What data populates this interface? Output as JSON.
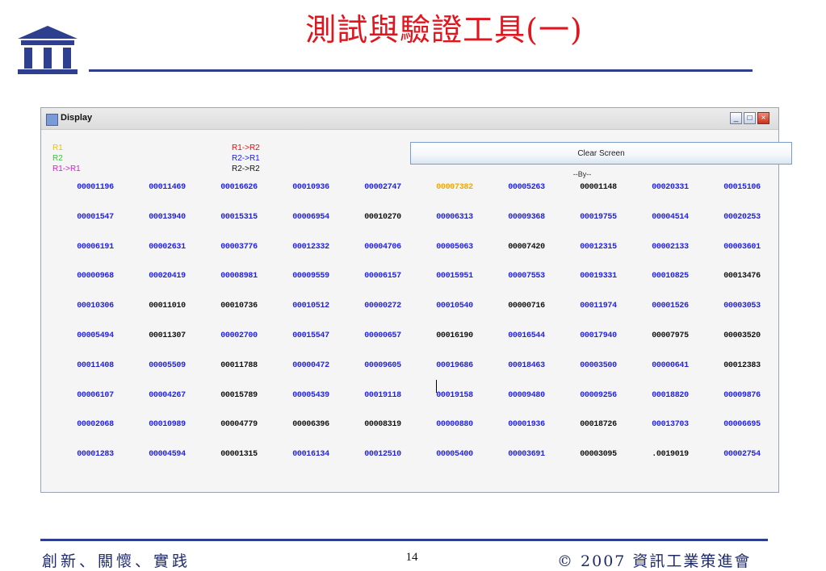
{
  "slide": {
    "title": "測試與驗證工具(一)",
    "footer_left": "創新、關懷、實践",
    "page_number": "14",
    "footer_right": "© 2007 資訊工業策進會"
  },
  "window": {
    "title": "Display",
    "controls": {
      "minimize": "_",
      "maximize": "□",
      "close": "×"
    }
  },
  "legend": {
    "items": [
      {
        "label": "R1",
        "color": "#e8c400"
      },
      {
        "label": "R2",
        "color": "#3cc43c"
      },
      {
        "label": "R1->R1",
        "color": "#d020d0"
      },
      {
        "label": "R1->R2",
        "color": "#e01010"
      },
      {
        "label": "R2->R1",
        "color": "#1a1ae8"
      },
      {
        "label": "R2->R2",
        "color": "#111111"
      }
    ]
  },
  "clear_button": {
    "label": "Clear Screen"
  },
  "by_label": "--By--",
  "colors": {
    "blue": "#2222dd",
    "black": "#111111",
    "yellow": "#f0a800"
  },
  "grid": {
    "rows": [
      [
        [
          "00001196",
          "b"
        ],
        [
          "00011469",
          "b"
        ],
        [
          "00016626",
          "b"
        ],
        [
          "00010936",
          "b"
        ],
        [
          "00002747",
          "b"
        ],
        [
          "00007382",
          "y"
        ],
        [
          "00005263",
          "b"
        ],
        [
          "00001148",
          "k"
        ],
        [
          "00020331",
          "b"
        ],
        [
          "00015106",
          "b"
        ]
      ],
      [
        [
          "00001547",
          "b"
        ],
        [
          "00013940",
          "b"
        ],
        [
          "00015315",
          "b"
        ],
        [
          "00006954",
          "b"
        ],
        [
          "00010270",
          "k"
        ],
        [
          "00006313",
          "b"
        ],
        [
          "00009368",
          "b"
        ],
        [
          "00019755",
          "b"
        ],
        [
          "00004514",
          "b"
        ],
        [
          "00020253",
          "b"
        ]
      ],
      [
        [
          "00006191",
          "b"
        ],
        [
          "00002631",
          "b"
        ],
        [
          "00003776",
          "b"
        ],
        [
          "00012332",
          "b"
        ],
        [
          "00004706",
          "b"
        ],
        [
          "00005063",
          "b"
        ],
        [
          "00007420",
          "k"
        ],
        [
          "00012315",
          "b"
        ],
        [
          "00002133",
          "b"
        ],
        [
          "00003601",
          "b"
        ]
      ],
      [
        [
          "00000968",
          "b"
        ],
        [
          "00020419",
          "b"
        ],
        [
          "00008981",
          "b"
        ],
        [
          "00009559",
          "b"
        ],
        [
          "00006157",
          "b"
        ],
        [
          "00015951",
          "b"
        ],
        [
          "00007553",
          "b"
        ],
        [
          "00019331",
          "b"
        ],
        [
          "00010825",
          "b"
        ],
        [
          "00013476",
          "k"
        ]
      ],
      [
        [
          "00010306",
          "b"
        ],
        [
          "00011010",
          "k"
        ],
        [
          "00010736",
          "k"
        ],
        [
          "00010512",
          "b"
        ],
        [
          "00000272",
          "b"
        ],
        [
          "00010540",
          "b"
        ],
        [
          "00000716",
          "k"
        ],
        [
          "00011974",
          "b"
        ],
        [
          "00001526",
          "b"
        ],
        [
          "00003053",
          "b"
        ]
      ],
      [
        [
          "00005494",
          "b"
        ],
        [
          "00011307",
          "k"
        ],
        [
          "00002700",
          "b"
        ],
        [
          "00015547",
          "b"
        ],
        [
          "00000657",
          "b"
        ],
        [
          "00016190",
          "k"
        ],
        [
          "00016544",
          "b"
        ],
        [
          "00017940",
          "b"
        ],
        [
          "00007975",
          "k"
        ],
        [
          "00003520",
          "k"
        ]
      ],
      [
        [
          "00011408",
          "b"
        ],
        [
          "00005509",
          "b"
        ],
        [
          "00011788",
          "k"
        ],
        [
          "00000472",
          "b"
        ],
        [
          "00009605",
          "b"
        ],
        [
          "00019686",
          "b"
        ],
        [
          "00018463",
          "b"
        ],
        [
          "00003500",
          "b"
        ],
        [
          "00000641",
          "b"
        ],
        [
          "00012383",
          "k"
        ]
      ],
      [
        [
          "00006107",
          "b"
        ],
        [
          "00004267",
          "b"
        ],
        [
          "00015789",
          "k"
        ],
        [
          "00005439",
          "b"
        ],
        [
          "00019118",
          "b"
        ],
        [
          "00019158",
          "b"
        ],
        [
          "00009480",
          "b"
        ],
        [
          "00009256",
          "b"
        ],
        [
          "00018820",
          "b"
        ],
        [
          "00009876",
          "b"
        ]
      ],
      [
        [
          "00002068",
          "b"
        ],
        [
          "00010989",
          "b"
        ],
        [
          "00004779",
          "k"
        ],
        [
          "00006396",
          "k"
        ],
        [
          "00008319",
          "k"
        ],
        [
          "00000880",
          "b"
        ],
        [
          "00001936",
          "b"
        ],
        [
          "00018726",
          "k"
        ],
        [
          "00013703",
          "b"
        ],
        [
          "00006695",
          "b"
        ]
      ],
      [
        [
          "00001283",
          "b"
        ],
        [
          "00004594",
          "b"
        ],
        [
          "00001315",
          "k"
        ],
        [
          "00016134",
          "b"
        ],
        [
          "00012510",
          "b"
        ],
        [
          "00005400",
          "b"
        ],
        [
          "00003691",
          "b"
        ],
        [
          "00003095",
          "k"
        ],
        [
          ".0019019",
          "k"
        ],
        [
          "00002754",
          "b"
        ]
      ]
    ]
  }
}
